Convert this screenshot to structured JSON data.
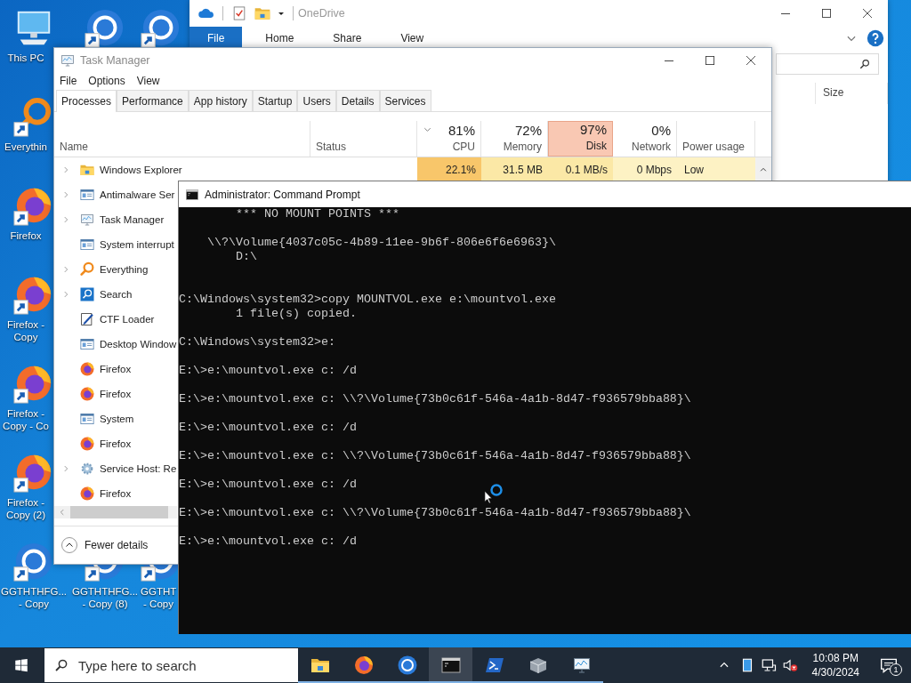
{
  "desktop_icon_columns": [
    [
      {
        "kind": "computer",
        "shortcut": false,
        "label": "This PC"
      },
      {
        "kind": "magnifier",
        "shortcut": true,
        "label": "Everythin"
      },
      {
        "kind": "globe",
        "shortcut": true,
        "label": "Firefox"
      },
      {
        "kind": "globe",
        "shortcut": true,
        "label": "Firefox - Copy"
      },
      {
        "kind": "globe",
        "shortcut": true,
        "label": "Firefox - Copy - Co"
      },
      {
        "kind": "globe",
        "shortcut": true,
        "label": "Firefox - Copy (2)"
      },
      {
        "kind": "ring",
        "shortcut": true,
        "label": "GGTHTHFG... - Copy"
      }
    ],
    [
      {
        "kind": "ring",
        "shortcut": true
      },
      {
        "kind": "ring",
        "shortcut": true,
        "label": "GGTHTHFG... - Copy (8)"
      }
    ],
    [
      {
        "kind": "ring",
        "shortcut": true
      },
      {
        "kind": "ring",
        "shortcut": true,
        "label": "GGTHT - Copy"
      }
    ]
  ],
  "explorer": {
    "title": "OneDrive",
    "ribbon_tabs": [
      {
        "label": "File",
        "kind": "file"
      },
      {
        "label": "Home",
        "kind": "tab"
      },
      {
        "label": "Share",
        "kind": "tab"
      },
      {
        "label": "View",
        "kind": "tab"
      }
    ],
    "column_header": "Size"
  },
  "task_manager": {
    "title": "Task Manager",
    "menu": [
      "File",
      "Options",
      "View"
    ],
    "tabs": [
      {
        "label": "Processes",
        "selected": true
      },
      {
        "label": "Performance",
        "selected": false
      },
      {
        "label": "App history",
        "selected": false
      },
      {
        "label": "Startup",
        "selected": false
      },
      {
        "label": "Users",
        "selected": false
      },
      {
        "label": "Details",
        "selected": false
      },
      {
        "label": "Services",
        "selected": false
      }
    ],
    "columns": [
      {
        "label": "Name"
      },
      {
        "label": "Status"
      },
      {
        "label": "CPU",
        "total": "81%",
        "sorted": true,
        "highlighted": false
      },
      {
        "label": "Memory",
        "total": "72%",
        "sorted": false,
        "highlighted": false
      },
      {
        "label": "Disk",
        "total": "97%",
        "sorted": false,
        "highlighted": true
      },
      {
        "label": "Network",
        "total": "0%",
        "sorted": false,
        "highlighted": false
      },
      {
        "label": "Power usage"
      }
    ],
    "rows": [
      {
        "kind": "folder",
        "name": "Windows Explorer",
        "expandable": true,
        "cells": [
          {
            "text": "22.1%",
            "color": "#f8c66a"
          },
          {
            "text": "31.5 MB",
            "color": "#fbe8a6"
          },
          {
            "text": "0.1 MB/s",
            "color": "#fbe8a6"
          },
          {
            "text": "0 Mbps",
            "color": "#fdf2c4"
          },
          {
            "text": "Low",
            "color": "#fdf2c4"
          }
        ]
      },
      {
        "kind": "window",
        "name": "Antimalware Ser",
        "expandable": true
      },
      {
        "kind": "monitor",
        "name": "Task Manager",
        "expandable": true
      },
      {
        "kind": "window",
        "name": "System interrupt",
        "expandable": false
      },
      {
        "kind": "magnifier",
        "name": "Everything",
        "expandable": true
      },
      {
        "kind": "search",
        "name": "Search",
        "expandable": true
      },
      {
        "kind": "pen",
        "name": "CTF Loader",
        "expandable": false
      },
      {
        "kind": "window",
        "name": "Desktop Window",
        "expandable": false
      },
      {
        "kind": "globe",
        "name": "Firefox",
        "expandable": false
      },
      {
        "kind": "globe",
        "name": "Firefox",
        "expandable": false
      },
      {
        "kind": "window",
        "name": "System",
        "expandable": false
      },
      {
        "kind": "globe",
        "name": "Firefox",
        "expandable": false
      },
      {
        "kind": "gear",
        "name": "Service Host: Re",
        "expandable": true
      },
      {
        "kind": "globe",
        "name": "Firefox",
        "expandable": false
      }
    ],
    "fewer_details": "Fewer details"
  },
  "console": {
    "title": "Administrator: Command Prompt",
    "output": "        *** NO MOUNT POINTS ***\n\n    \\\\?\\Volume{4037c05c-4b89-11ee-9b6f-806e6f6e6963}\\\n        D:\\\n\n\nC:\\Windows\\system32>copy MOUNTVOL.exe e:\\mountvol.exe\n        1 file(s) copied.\n\nC:\\Windows\\system32>e:\n\nE:\\>e:\\mountvol.exe c: /d\n\nE:\\>e:\\mountvol.exe c: \\\\?\\Volume{73b0c61f-546a-4a1b-8d47-f936579bba88}\\\n\nE:\\>e:\\mountvol.exe c: /d\n\nE:\\>e:\\mountvol.exe c: \\\\?\\Volume{73b0c61f-546a-4a1b-8d47-f936579bba88}\\\n\nE:\\>e:\\mountvol.exe c: /d\n\nE:\\>e:\\mountvol.exe c: \\\\?\\Volume{73b0c61f-546a-4a1b-8d47-f936579bba88}\\\n\nE:\\>e:\\mountvol.exe c: /d"
  },
  "taskbar": {
    "search_placeholder": "Type here to search",
    "apps": [
      {
        "kind": "folder",
        "running": true,
        "active": false
      },
      {
        "kind": "globe",
        "running": true,
        "active": false
      },
      {
        "kind": "ring",
        "running": true,
        "active": false
      },
      {
        "kind": "terminal",
        "running": true,
        "active": true
      },
      {
        "kind": "shell",
        "running": true,
        "active": false
      },
      {
        "kind": "package",
        "running": true,
        "active": false
      },
      {
        "kind": "monitor",
        "running": true,
        "active": false
      }
    ],
    "time": "10:08 PM",
    "date": "4/30/2024",
    "notifications": "1"
  }
}
